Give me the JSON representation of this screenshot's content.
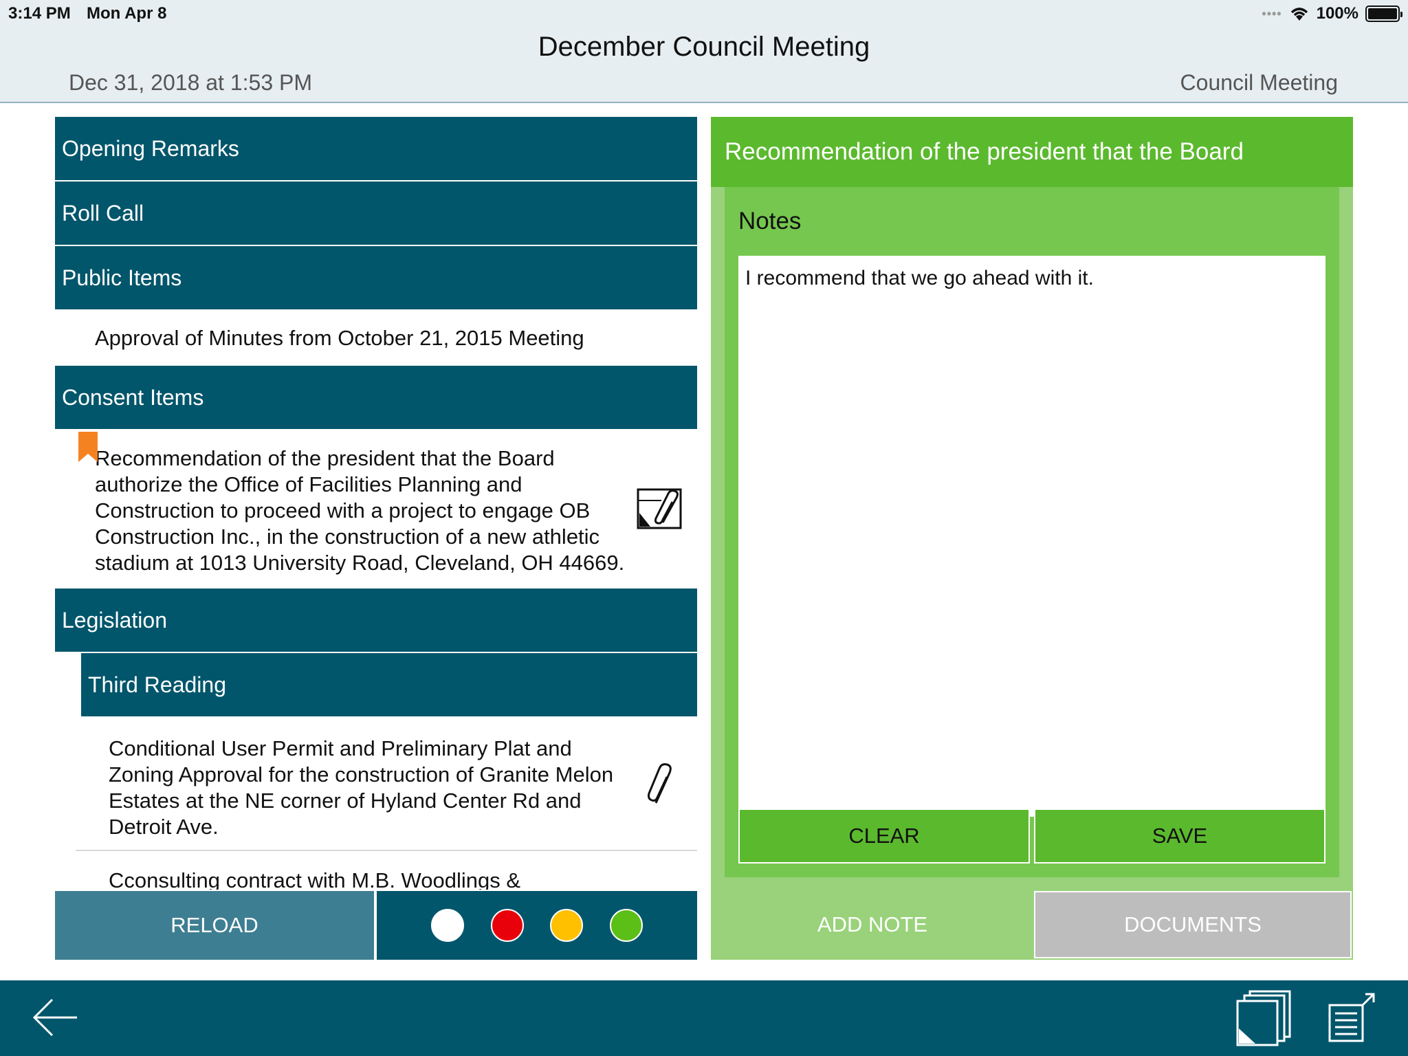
{
  "status_bar": {
    "time": "3:14 PM",
    "date": "Mon Apr 8",
    "battery": "100%",
    "battery_level": 1.0
  },
  "header": {
    "title": "December Council Meeting",
    "date": "Dec 31, 2018 at 1:53 PM",
    "type": "Council Meeting"
  },
  "agenda": {
    "sections": {
      "opening": "Opening Remarks",
      "roll_call": "Roll Call",
      "public": "Public Items",
      "consent": "Consent Items",
      "legislation": "Legislation",
      "third_reading": "Third Reading"
    },
    "public_item": "Approval of Minutes from October 21, 2015 Meeting",
    "consent_item": {
      "lines": [
        "Recommendation of the president that the Board",
        "authorize the Office of Facilities Planning and",
        "Construction to proceed with a project to engage OB",
        "Construction Inc., in the construction of a new athletic",
        "stadium at 1013 University Road, Cleveland, OH 44669."
      ],
      "bookmark_color": "#f58220"
    },
    "third_reading_item": {
      "lines": [
        "Conditional User Permit and Preliminary Plat and",
        "Zoning Approval for the construction of Granite Melon",
        "Estates at the NE corner of Hyland Center Rd and",
        "Detroit Ave."
      ]
    },
    "partial_item": "Cconsulting contract with M.B. Woodlings &"
  },
  "toolbar": {
    "reload_label": "RELOAD",
    "colors": [
      "#ffffff",
      "#e8000b",
      "#ffc000",
      "#5bbf17"
    ]
  },
  "notes_panel": {
    "header": "Recommendation of the president that the Board",
    "label": "Notes",
    "note_text": "I recommend that we go ahead with it.",
    "clear_label": "CLEAR",
    "save_label": "SAVE",
    "add_note_tab": "ADD NOTE",
    "documents_tab": "DOCUMENTS"
  },
  "bottom_nav": {
    "icons": [
      "back-arrow-icon",
      "documents-stack-icon",
      "export-list-icon"
    ]
  }
}
